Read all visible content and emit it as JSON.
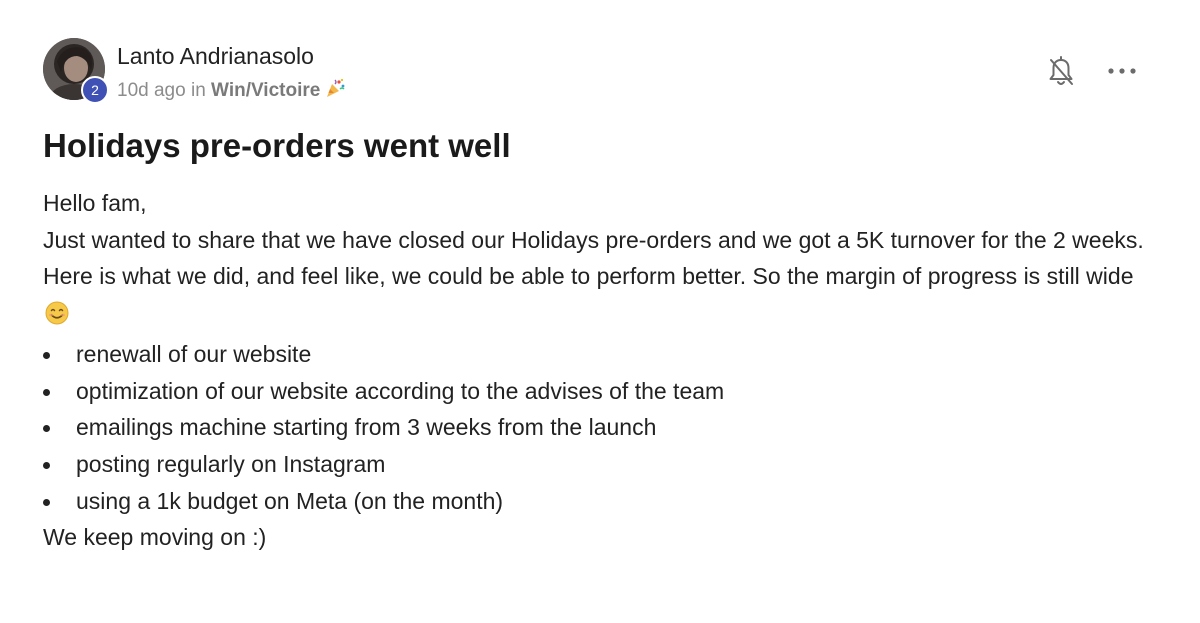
{
  "author": {
    "name": "Lanto Andrianasolo",
    "level": "2",
    "avatar_icon": "user-photo"
  },
  "meta": {
    "time": "10d ago",
    "in": "in",
    "category": "Win/Victoire",
    "category_icon": "party-popper-icon"
  },
  "actions": {
    "notifications_icon": "bell-off-icon",
    "more_icon": "more-horizontal-icon"
  },
  "post": {
    "title": "Holidays pre-orders went well",
    "greeting": "Hello fam,",
    "paragraph1": "Just wanted to share that we have closed our Holidays pre-orders and we got a 5K turnover for the 2 weeks.",
    "paragraph2": "Here is what we did, and feel like, we could be able to perform better. So the margin of progress is still wide",
    "paragraph2_emoji": "smiling-face-icon",
    "bullets": [
      "renewall of our website",
      "optimization of our website according to the advises of the team",
      "emailings machine starting from 3 weeks from the launch",
      "posting regularly on Instagram",
      "using a 1k budget on Meta (on the month)"
    ],
    "closing": "We keep moving on :)"
  },
  "colors": {
    "badge": "#3f51b5",
    "meta_text": "#8c8c8c",
    "body_text": "#222222"
  }
}
